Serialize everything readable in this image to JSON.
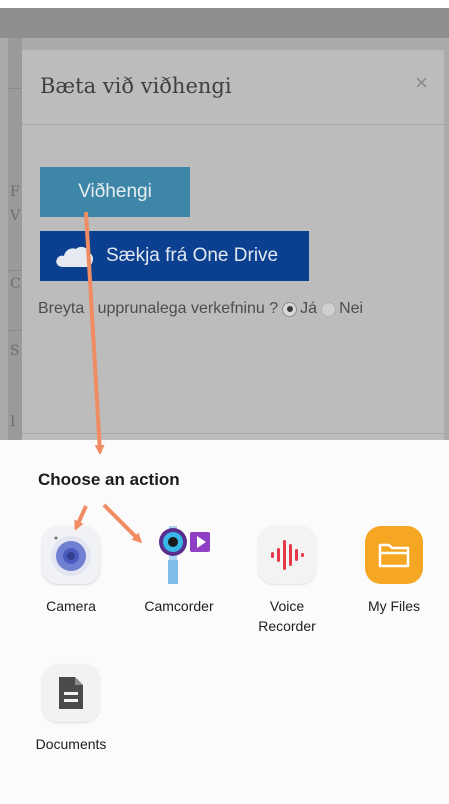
{
  "dialog": {
    "title": "Bæta við viðhengi",
    "close_glyph": "×",
    "attach_button": "Viðhengi",
    "onedrive_button": "Sækja frá One Drive",
    "modify_prompt": "Breyta í upprunalega verkefninu ?",
    "radio_yes": "Já",
    "radio_no": "Nei",
    "selected_option": "Já"
  },
  "background_page": {
    "edge_letters": [
      "F",
      "V",
      "C",
      "S",
      "I"
    ]
  },
  "sheet": {
    "title": "Choose an action",
    "apps": [
      {
        "label": "Camera",
        "icon": "camera-icon"
      },
      {
        "label": "Camcorder",
        "icon": "camcorder-icon"
      },
      {
        "label": "Voice Recorder",
        "icon": "voice-recorder-icon"
      },
      {
        "label": "My Files",
        "icon": "folder-icon"
      },
      {
        "label": "Documents",
        "icon": "document-icon"
      }
    ]
  },
  "colors": {
    "attach_button": "#3e86a8",
    "onedrive_button": "#0b3f8f",
    "arrow": "#f08c63",
    "my_files": "#f5a623",
    "voice_recorder": "#e8364a",
    "camcorder": "#8e3fc4"
  }
}
